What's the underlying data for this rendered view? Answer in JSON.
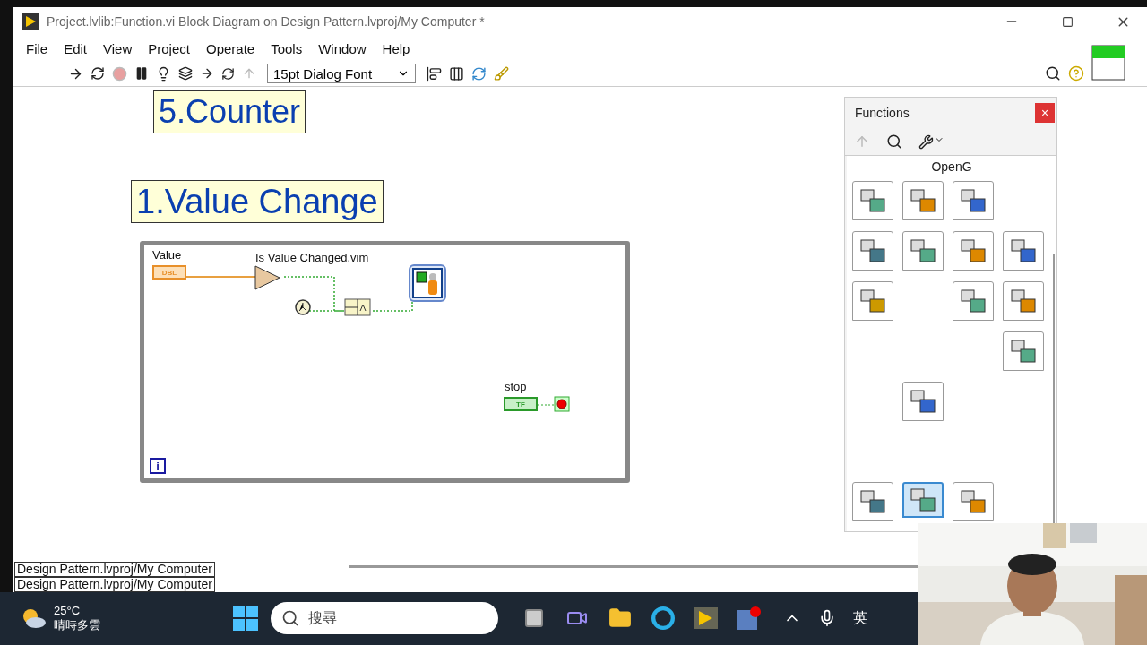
{
  "window": {
    "title": "Project.lvlib:Function.vi Block Diagram on Design Pattern.lvproj/My Computer *"
  },
  "menu": [
    "File",
    "Edit",
    "View",
    "Project",
    "Operate",
    "Tools",
    "Window",
    "Help"
  ],
  "toolbar": {
    "font": "15pt Dialog Font",
    "abort_disabled": true,
    "step_out_disabled": true
  },
  "diagram": {
    "labels": [
      "5.Counter",
      "1.Value Change"
    ],
    "loop": {
      "value_label": "Value",
      "value_type": "DBL",
      "subvi_label": "Is Value Changed.vim",
      "stop_label": "stop",
      "stop_type": "TF",
      "iteration": "i"
    }
  },
  "palette": {
    "title": "Functions",
    "close": "×",
    "category": "OpenG",
    "rows": [
      {
        "items": [
          {
            "kind": "folder",
            "selected": false
          },
          {
            "kind": "folder",
            "selected": false
          },
          {
            "kind": "folder",
            "selected": false
          },
          {
            "kind": "empty"
          }
        ]
      },
      {
        "items": [
          {
            "kind": "folder",
            "selected": false
          },
          {
            "kind": "folder",
            "selected": false
          },
          {
            "kind": "folder",
            "selected": false
          },
          {
            "kind": "folder",
            "selected": false
          }
        ]
      },
      {
        "items": [
          {
            "kind": "folder",
            "selected": false
          },
          {
            "kind": "empty"
          },
          {
            "kind": "folder",
            "selected": false
          },
          {
            "kind": "folder",
            "selected": false
          }
        ]
      },
      {
        "items": [
          {
            "kind": "empty"
          },
          {
            "kind": "empty"
          },
          {
            "kind": "empty"
          },
          {
            "kind": "folder",
            "selected": false
          }
        ]
      },
      {
        "items": [
          {
            "kind": "empty"
          },
          {
            "kind": "folder",
            "selected": false
          },
          {
            "kind": "empty"
          },
          {
            "kind": "empty"
          }
        ]
      },
      {
        "items": [
          {
            "kind": "empty"
          },
          {
            "kind": "empty"
          },
          {
            "kind": "empty"
          },
          {
            "kind": "empty"
          }
        ]
      },
      {
        "items": [
          {
            "kind": "folder",
            "selected": false
          },
          {
            "kind": "folder",
            "selected": true
          },
          {
            "kind": "folder",
            "selected": false
          },
          {
            "kind": "empty"
          }
        ]
      }
    ]
  },
  "status_bar": [
    "Design Pattern.lvproj/My Computer",
    "Design Pattern.lvproj/My Computer"
  ],
  "taskbar": {
    "temperature": "25°C",
    "weather": "晴時多雲",
    "search_placeholder": "搜尋",
    "ime": "英"
  }
}
